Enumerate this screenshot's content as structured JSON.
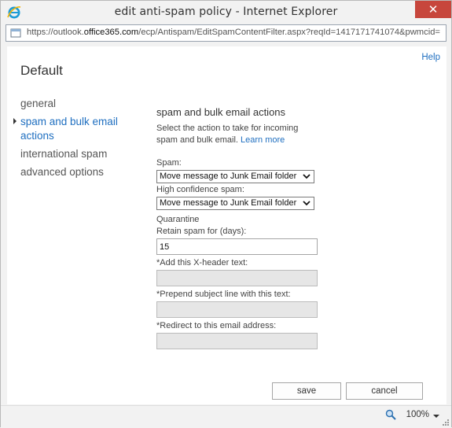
{
  "window": {
    "title": "edit anti-spam policy - Internet Explorer",
    "close_label": "✕"
  },
  "address_bar": {
    "scheme": "https://",
    "host_prefix": "outlook.",
    "host_domain": "office365.com",
    "path": "/ecp/Antispam/EditSpamContentFilter.aspx?reqId=1417171741074&pwmcid="
  },
  "header": {
    "help_label": "Help",
    "page_title": "Default"
  },
  "nav": {
    "items": [
      {
        "label": "general",
        "active": false
      },
      {
        "label": "spam and bulk email actions",
        "active": true
      },
      {
        "label": "international spam",
        "active": false
      },
      {
        "label": "advanced options",
        "active": false
      }
    ]
  },
  "section": {
    "title": "spam and bulk email actions",
    "description": "Select the action to take for incoming spam and bulk email.",
    "learn_more": "Learn more"
  },
  "form": {
    "spam_label": "Spam:",
    "spam_value": "Move message to Junk Email folder",
    "high_conf_label": "High confidence spam:",
    "high_conf_value": "Move message to Junk Email folder",
    "quarantine_label": "Quarantine",
    "retain_label": "Retain spam for (days):",
    "retain_value": "15",
    "xheader_label": "*Add this X-header text:",
    "xheader_value": "",
    "prepend_label": "*Prepend subject line with this text:",
    "prepend_value": "",
    "redirect_label": "*Redirect to this email address:",
    "redirect_value": ""
  },
  "buttons": {
    "save": "save",
    "cancel": "cancel"
  },
  "status_bar": {
    "zoom": "100%"
  },
  "colors": {
    "accent": "#1f6fc0",
    "close_button": "#c7463c"
  }
}
